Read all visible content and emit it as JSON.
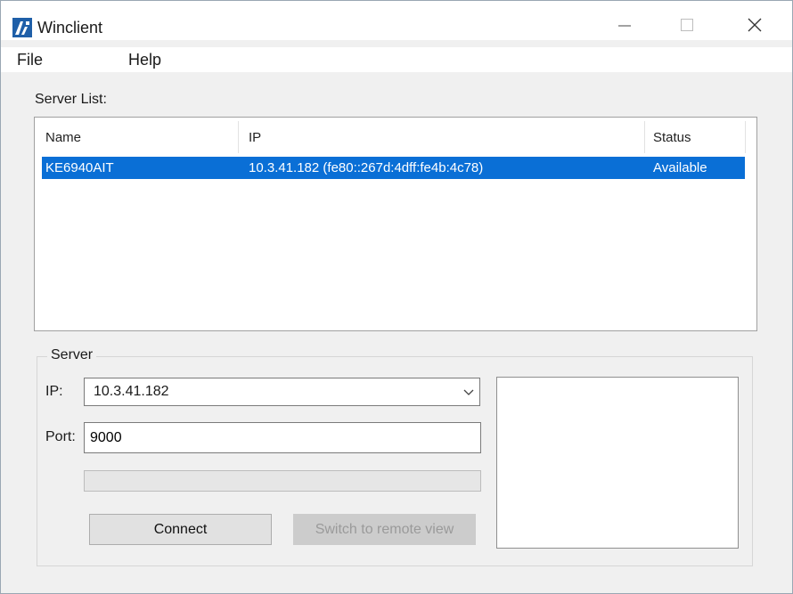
{
  "window": {
    "title": "Winclient"
  },
  "menu": {
    "items": [
      {
        "label": "File"
      },
      {
        "label": "Help"
      }
    ]
  },
  "server_list": {
    "label": "Server List:",
    "columns": [
      "Name",
      "IP",
      "Status"
    ],
    "rows": [
      {
        "name": "KE6940AIT",
        "ip": "10.3.41.182 (fe80::267d:4dff:fe4b:4c78)",
        "status": "Available",
        "selected": true
      }
    ]
  },
  "server": {
    "group_label": "Server",
    "ip_label": "IP:",
    "ip_value": "10.3.41.182",
    "port_label": "Port:",
    "port_value": "9000",
    "progress_percent": 0,
    "connect_label": "Connect",
    "switch_label": "Switch to remote view"
  },
  "colors": {
    "selection": "#0a6fd6",
    "window_bg": "#f0f0f0"
  }
}
